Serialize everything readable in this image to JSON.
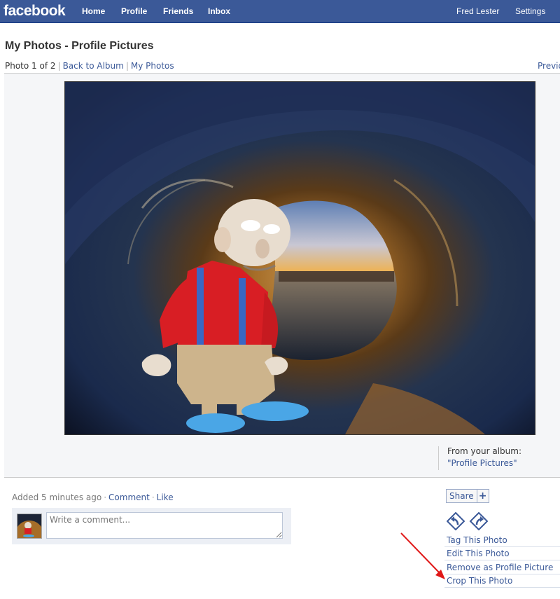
{
  "topbar": {
    "logo": "facebook",
    "nav": [
      "Home",
      "Profile",
      "Friends",
      "Inbox"
    ],
    "user_name": "Fred Lester",
    "settings": "Settings"
  },
  "header": {
    "title": "My Photos - Profile Pictures",
    "photo_counter": "Photo 1 of 2",
    "back_to_album": "Back to Album",
    "my_photos": "My Photos",
    "previous": "Previous"
  },
  "album": {
    "from_label": "From your album:",
    "name": "\"Profile Pictures\""
  },
  "meta": {
    "added": "Added 5 minutes ago",
    "comment": "Comment",
    "like": "Like"
  },
  "comment_box": {
    "placeholder": "Write a comment..."
  },
  "sidebar": {
    "share": "Share",
    "share_plus": "+",
    "actions": [
      "Tag This Photo",
      "Edit This Photo",
      "Remove as Profile Picture",
      "Crop This Photo"
    ]
  },
  "colors": {
    "brand": "#3b5998",
    "annotation_arrow": "#e01818"
  },
  "icons": [
    "rotate-left-icon",
    "rotate-right-icon",
    "annotation-arrow"
  ]
}
